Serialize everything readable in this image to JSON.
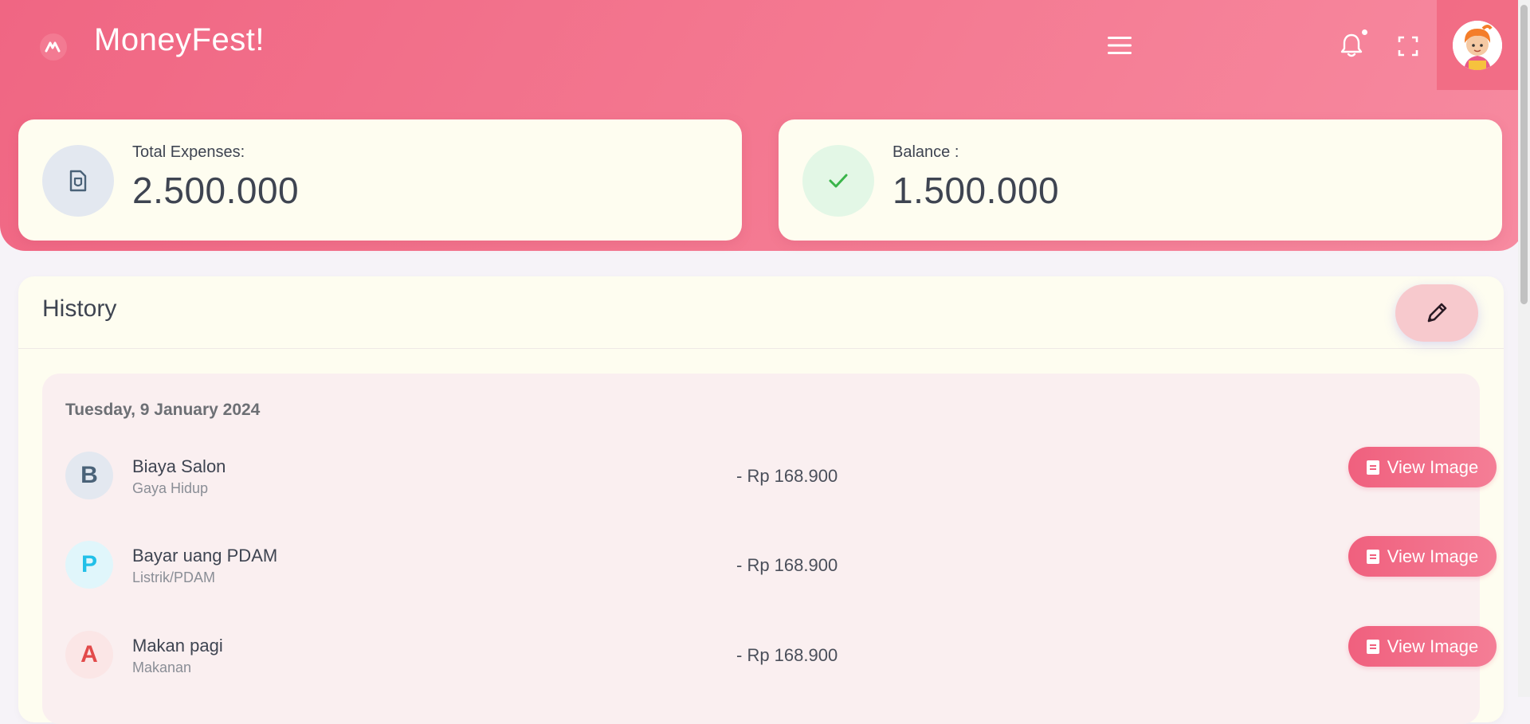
{
  "header": {
    "app_title": "MoneyFest!",
    "menu_icon": "hamburger-menu-icon",
    "notification_icon": "bell-icon",
    "fullscreen_icon": "fullscreen-icon",
    "avatar_icon": "user-avatar"
  },
  "stats": {
    "expenses": {
      "label": "Total Expenses:",
      "value": "2.500.000",
      "icon": "receipt-icon"
    },
    "balance": {
      "label": "Balance :",
      "value": "1.500.000",
      "icon": "check-icon"
    }
  },
  "history": {
    "title": "History",
    "edit_icon": "pencil-icon",
    "day": "Tuesday, 9 January 2024",
    "transactions": [
      {
        "initial": "B",
        "name": "Biaya Salon",
        "category": "Gaya Hidup",
        "amount": "- Rp 168.900",
        "button": "View Image",
        "color": "#4a6278",
        "bg": "#e3e8f0"
      },
      {
        "initial": "P",
        "name": "Bayar uang PDAM",
        "category": "Listrik/PDAM",
        "amount": "- Rp 168.900",
        "button": "View Image",
        "color": "#22c0e8",
        "bg": "#e0f6fb"
      },
      {
        "initial": "A",
        "name": "Makan pagi",
        "category": "Makanan",
        "amount": "- Rp 168.900",
        "button": "View Image",
        "color": "#e24a4a",
        "bg": "#fbe6e6"
      }
    ]
  },
  "colors": {
    "accent": "#f0607e",
    "card": "#fefdf0",
    "panel": "#faeff0"
  }
}
